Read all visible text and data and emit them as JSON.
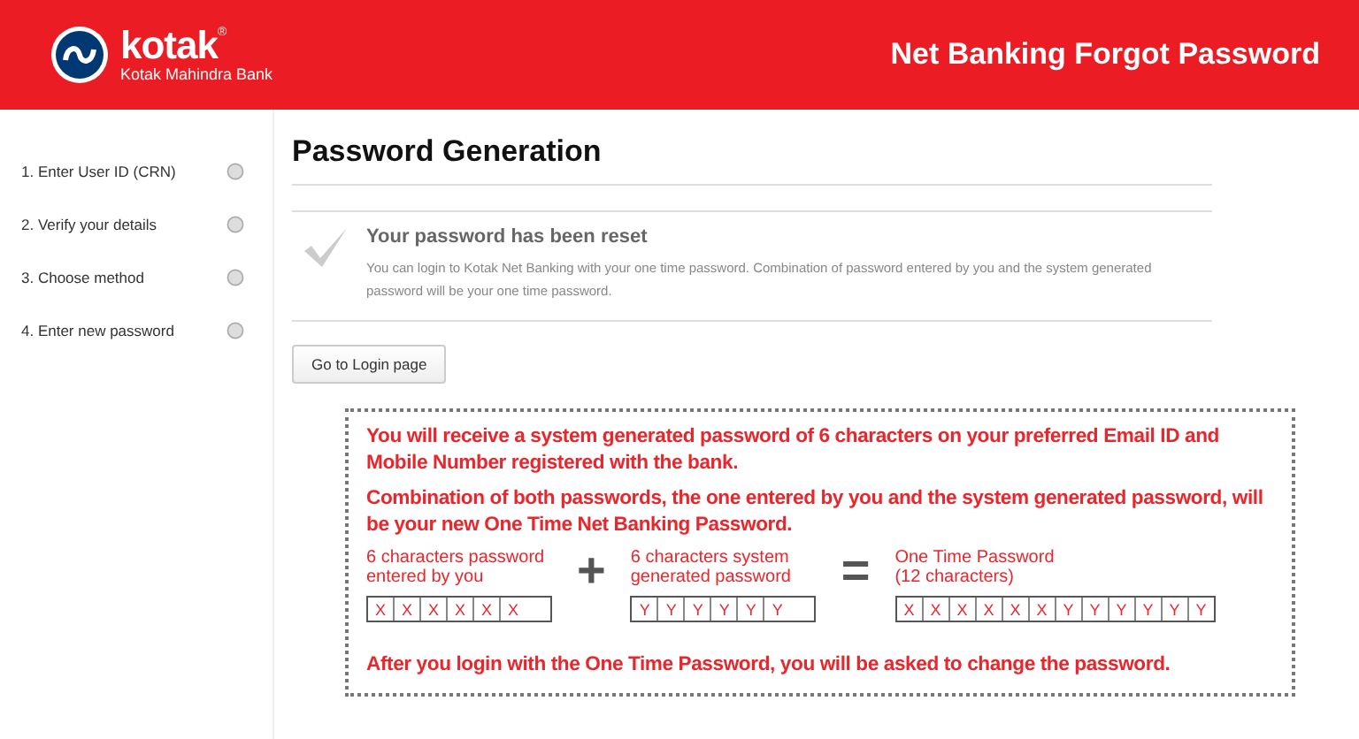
{
  "header": {
    "brand": "kotak",
    "registered": "®",
    "tagline": "Kotak Mahindra Bank",
    "title": "Net Banking Forgot Password"
  },
  "steps": [
    {
      "label": "1. Enter User ID (CRN)"
    },
    {
      "label": "2. Verify your details"
    },
    {
      "label": "3. Choose method"
    },
    {
      "label": "4. Enter new password"
    }
  ],
  "heading": "Password Generation",
  "notice": {
    "title": "Your password has been reset",
    "text": "You can login to Kotak Net Banking with your one time password. Combination of password entered by you and the system generated password will be your one time password."
  },
  "login_button": "Go to Login page",
  "info": {
    "paragraphs": [
      "You will receive a system generated password of 6 characters on your preferred Email ID and Mobile Number registered with the bank.",
      "Combination of both passwords, the one entered by you and the system generated password, will be your new One Time Net Banking Password."
    ],
    "equation": [
      {
        "kind": "group",
        "label": "6 characters password entered by you",
        "chars": [
          "X",
          "X",
          "X",
          "X",
          "X",
          "X"
        ]
      },
      {
        "kind": "operator",
        "symbol": "+"
      },
      {
        "kind": "group",
        "label": "6 characters system generated password",
        "chars": [
          "Y",
          "Y",
          "Y",
          "Y",
          "Y",
          "Y"
        ]
      },
      {
        "kind": "operator",
        "symbol": "="
      },
      {
        "kind": "group",
        "label": "One Time Password (12 characters)",
        "chars": [
          "X",
          "X",
          "X",
          "X",
          "X",
          "X",
          "Y",
          "Y",
          "Y",
          "Y",
          "Y",
          "Y"
        ]
      }
    ],
    "footer": "After you login with the One Time Password, you will be asked to change the password."
  }
}
